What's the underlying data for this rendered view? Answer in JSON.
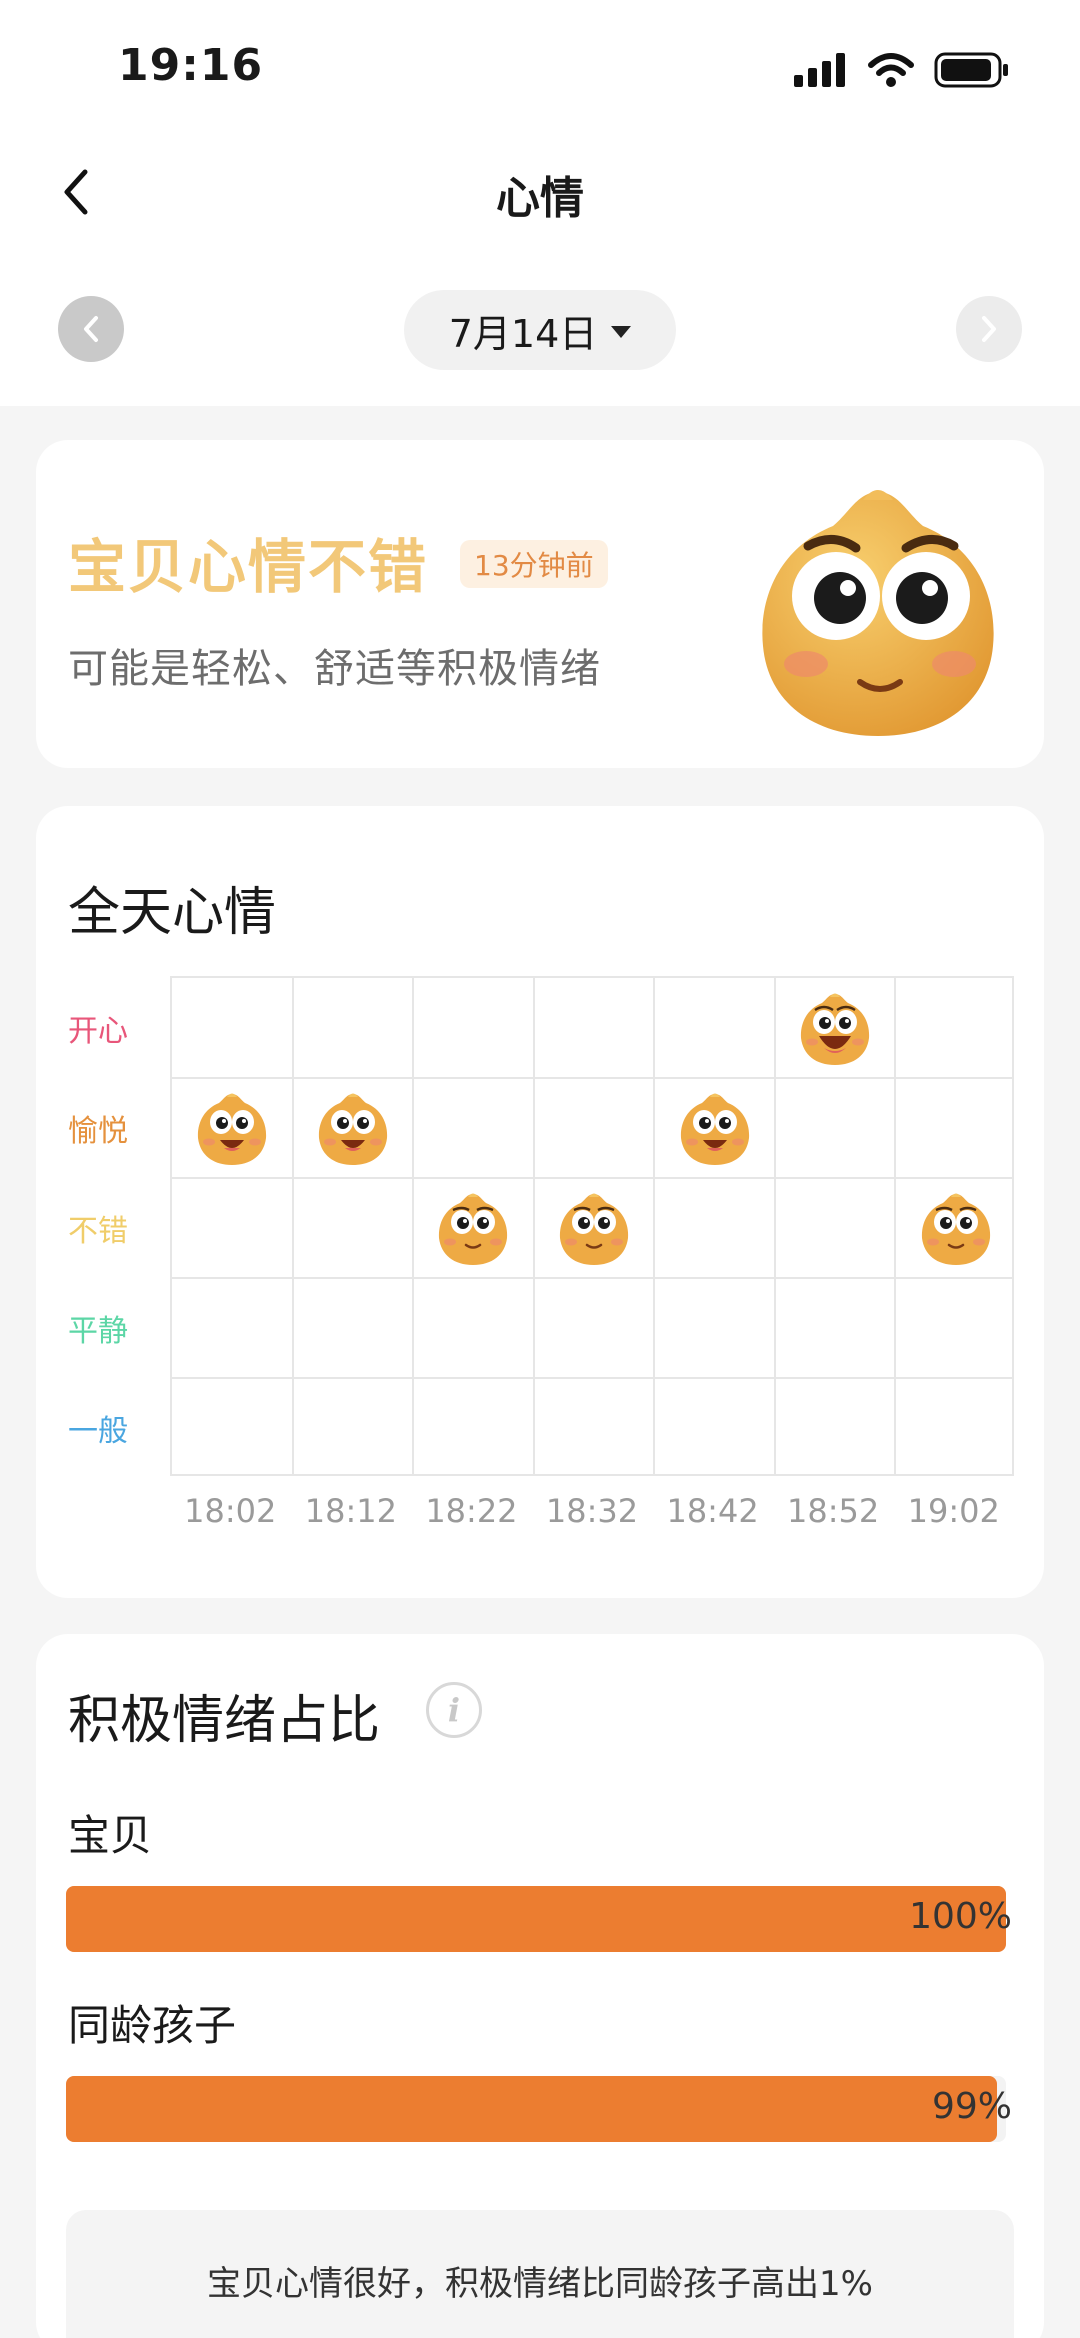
{
  "status": {
    "time": "19:16"
  },
  "header": {
    "title": "心情"
  },
  "date_nav": {
    "date": "7月14日"
  },
  "current_mood": {
    "headline": "宝贝心情不错",
    "time_ago": "13分钟前",
    "description": "可能是轻松、舒适等积极情绪"
  },
  "daily_mood": {
    "title": "全天心情",
    "levels": [
      {
        "label": "开心",
        "color": "#e8567a"
      },
      {
        "label": "愉悦",
        "color": "#e5913d"
      },
      {
        "label": "不错",
        "color": "#f0cd6a"
      },
      {
        "label": "平静",
        "color": "#5cd6a6"
      },
      {
        "label": "一般",
        "color": "#4aa6e0"
      }
    ],
    "times": [
      "18:02",
      "18:12",
      "18:22",
      "18:32",
      "18:42",
      "18:52",
      "19:02"
    ]
  },
  "chart_data": {
    "type": "scatter",
    "title": "全天心情",
    "x": [
      "18:02",
      "18:12",
      "18:22",
      "18:32",
      "18:42",
      "18:52",
      "19:02"
    ],
    "y_categories": [
      "开心",
      "愉悦",
      "不错",
      "平静",
      "一般"
    ],
    "y": [
      "愉悦",
      "愉悦",
      "不错",
      "不错",
      "愉悦",
      "开心",
      "不错"
    ]
  },
  "positive_ratio": {
    "title": "积极情绪占比",
    "bars": [
      {
        "label": "宝贝",
        "value": 100,
        "display": "100%"
      },
      {
        "label": "同龄孩子",
        "value": 99,
        "display": "99%"
      }
    ],
    "summary": "宝贝心情很好，积极情绪比同龄孩子高出1%"
  },
  "colors": {
    "accent": "#ec7d30",
    "mascot": "#f0b04a"
  }
}
